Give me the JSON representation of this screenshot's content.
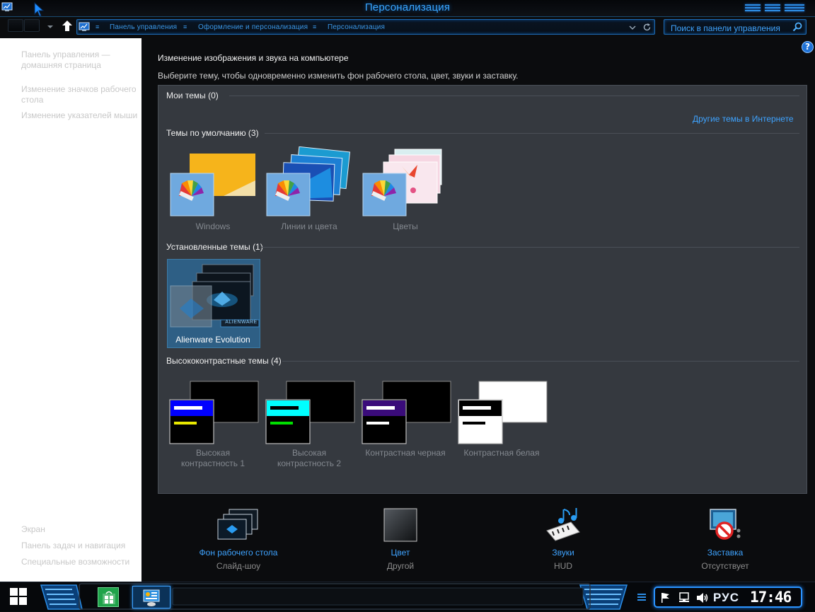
{
  "window": {
    "title": "Персонализация"
  },
  "navigation": {
    "breadcrumb": [
      "Панель управления",
      "Оформление и персонализация",
      "Персонализация"
    ],
    "search_placeholder": "Поиск в панели управления"
  },
  "sidebar": {
    "top_links": [
      "Панель управления — домашняя страница",
      "Изменение значков рабочего стола",
      "Изменение указателей мыши"
    ],
    "bottom_links": [
      "Экран",
      "Панель задач и навигация",
      "Специальные возможности"
    ]
  },
  "main": {
    "heading": "Изменение изображения и звука на компьютере",
    "subheading": "Выберите тему, чтобы одновременно изменить фон рабочего стола, цвет, звуки и заставку.",
    "more_themes_link": "Другие темы в Интернете",
    "groups": {
      "my": "Мои темы (0)",
      "default": "Темы по умолчанию (3)",
      "installed": "Установленные темы (1)",
      "high_contrast": "Высококонтрастные темы (4)"
    },
    "default_themes": [
      "Windows",
      "Линии и цвета",
      "Цветы"
    ],
    "installed_themes": [
      "Alienware Evolution"
    ],
    "installed_badge": "ALIENWARE",
    "high_contrast_themes": [
      "Высокая контрастность 1",
      "Высокая контрастность 2",
      "Контрастная черная",
      "Контрастная белая"
    ],
    "high_contrast_label_lines": [
      [
        "Высокая",
        "контрастность 1"
      ],
      [
        "Высокая",
        "контрастность 2"
      ],
      [
        "Контрастная черная"
      ],
      [
        "Контрастная белая"
      ]
    ]
  },
  "bottom_settings": [
    {
      "title": "Фон рабочего стола",
      "value": "Слайд-шоу",
      "icon": "desktop-background-icon"
    },
    {
      "title": "Цвет",
      "value": "Другой",
      "icon": "color-icon"
    },
    {
      "title": "Звуки",
      "value": "HUD",
      "icon": "sounds-icon"
    },
    {
      "title": "Заставка",
      "value": "Отсутствует",
      "icon": "screensaver-icon"
    }
  ],
  "taskbar": {
    "language": "РУС",
    "time": "17:46"
  },
  "colors": {
    "accent": "#3ea3ff",
    "panel": "#35393f",
    "background": "#0b0c0e",
    "sidebar": "#ffffff"
  }
}
